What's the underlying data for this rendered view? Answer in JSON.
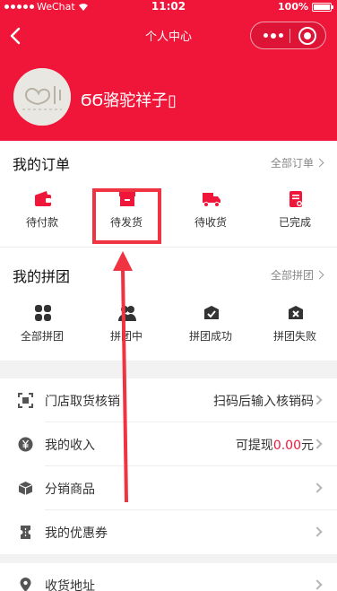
{
  "status_bar": {
    "carrier": "WeChat",
    "time": "11:02",
    "battery": "100%"
  },
  "navbar": {
    "title": "个人中心"
  },
  "profile": {
    "username": "ϬϬ骆驼祥子▯"
  },
  "orders": {
    "title": "我的订单",
    "more": "全部订单",
    "items": [
      {
        "label": "待付款",
        "icon": "wallet-icon"
      },
      {
        "label": "待发货",
        "icon": "box-icon"
      },
      {
        "label": "待收货",
        "icon": "truck-icon"
      },
      {
        "label": "已完成",
        "icon": "clipboard-icon"
      }
    ]
  },
  "groups": {
    "title": "我的拼团",
    "more": "全部拼团",
    "items": [
      {
        "label": "全部拼团",
        "icon": "clover-icon"
      },
      {
        "label": "拼团中",
        "icon": "people-icon"
      },
      {
        "label": "拼团成功",
        "icon": "box-check-icon"
      },
      {
        "label": "拼团失败",
        "icon": "box-x-icon"
      }
    ]
  },
  "menu": [
    {
      "label": "门店取货核销",
      "value": "扫码后输入核销码",
      "icon": "scan-icon"
    },
    {
      "label": "我的收入",
      "value_prefix": "可提现",
      "amount": "0.00",
      "value_suffix": "元",
      "icon": "yen-icon"
    },
    {
      "label": "分销商品",
      "icon": "cube-icon"
    },
    {
      "label": "我的优惠券",
      "icon": "coupon-icon"
    },
    {
      "label": "收货地址",
      "icon": "location-icon"
    }
  ],
  "colors": {
    "brand": "#f0163a",
    "annotation": "#ef3340"
  }
}
